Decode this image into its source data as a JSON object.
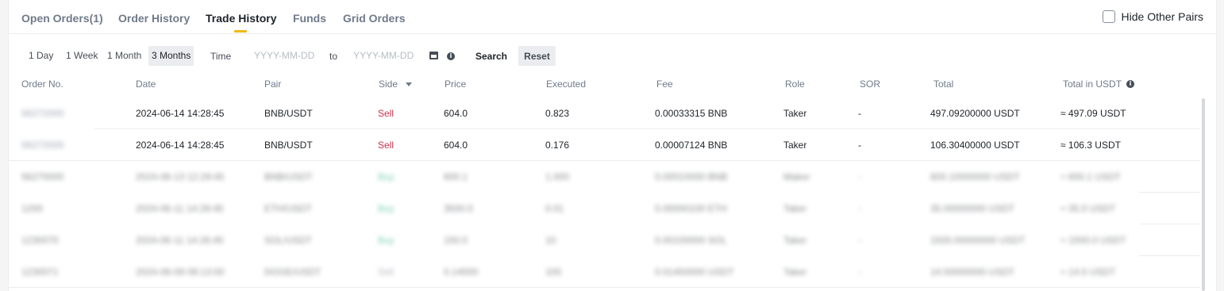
{
  "tabs": [
    {
      "label": "Open Orders(1)",
      "active": false
    },
    {
      "label": "Order History",
      "active": false
    },
    {
      "label": "Trade History",
      "active": true
    },
    {
      "label": "Funds",
      "active": false
    },
    {
      "label": "Grid Orders",
      "active": false
    }
  ],
  "hide_other_pairs": {
    "label": "Hide Other Pairs",
    "checked": false
  },
  "filter": {
    "ranges": [
      "1 Day",
      "1 Week",
      "1 Month",
      "3 Months"
    ],
    "active_range": "3 Months",
    "time_label": "Time",
    "start_placeholder": "YYYY-MM-DD",
    "to_label": "to",
    "end_placeholder": "YYYY-MM-DD",
    "search_label": "Search",
    "reset_label": "Reset"
  },
  "columns": [
    "Order No.",
    "Date",
    "Pair",
    "Side",
    "Price",
    "Executed",
    "Fee",
    "Role",
    "SOR",
    "Total",
    "Total in USDT"
  ],
  "rows": [
    {
      "order_no": "56272000",
      "date": "2024-06-14 14:28:45",
      "pair": "BNB/USDT",
      "side": "Sell",
      "price": "604.0",
      "executed": "0.823",
      "fee": "0.00033315 BNB",
      "role": "Taker",
      "sor": "-",
      "total": "497.09200000 USDT",
      "total_usdt": "≈ 497.09 USDT"
    },
    {
      "order_no": "56272000",
      "date": "2024-06-14 14:28:45",
      "pair": "BNB/USDT",
      "side": "Sell",
      "price": "604.0",
      "executed": "0.176",
      "fee": "0.00007124 BNB",
      "role": "Taker",
      "sor": "-",
      "total": "106.30400000 USDT",
      "total_usdt": "≈ 106.3 USDT"
    },
    {
      "order_no": "56270000",
      "date": "2024-06-13 12:29:45",
      "pair": "BNB/USDT",
      "side": "Buy",
      "price": "600.1",
      "executed": "1.000",
      "fee": "0.00010000 BNB",
      "role": "Maker",
      "sor": "-",
      "total": "600.10000000 USDT",
      "total_usdt": "≈ 600.1 USDT"
    },
    {
      "order_no": "1200",
      "date": "2024-06-11 14:28:45",
      "pair": "ETH/USDT",
      "side": "Buy",
      "price": "3500.0",
      "executed": "0.01",
      "fee": "0.00000100 ETH",
      "role": "Taker",
      "sor": "-",
      "total": "35.00000000 USDT",
      "total_usdt": "≈ 35.0 USDT"
    },
    {
      "order_no": "1230070",
      "date": "2024-06-11 14:26:45",
      "pair": "SOL/USDT",
      "side": "Buy",
      "price": "150.0",
      "executed": "10",
      "fee": "0.00100000 SOL",
      "role": "Taker",
      "sor": "-",
      "total": "1500.00000000 USDT",
      "total_usdt": "≈ 1500.0 USDT"
    },
    {
      "order_no": "1230071",
      "date": "2024-06-09 09:13:00",
      "pair": "DOGE/USDT",
      "side": "Sell",
      "price": "0.14500",
      "executed": "100",
      "fee": "0.01450000 USDT",
      "role": "Taker",
      "sor": "-",
      "total": "14.50000000 USDT",
      "total_usdt": "≈ 14.5 USDT"
    }
  ]
}
